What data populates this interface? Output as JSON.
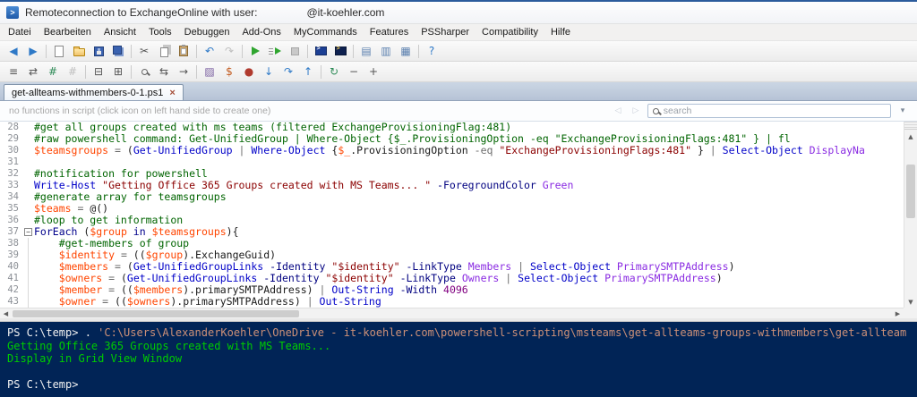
{
  "window": {
    "title_left": "Remoteconnection to ExchangeOnline with user:",
    "title_right": "@it-koehler.com",
    "app_icon": "powershell-ise-steroids"
  },
  "menu": {
    "items": [
      "Datei",
      "Bearbeiten",
      "Ansicht",
      "Tools",
      "Debuggen",
      "Add-Ons",
      "MyCommands",
      "Features",
      "PSSharper",
      "Compatibility",
      "Hilfe"
    ]
  },
  "toolbar1": {
    "icons": [
      {
        "name": "nav-back-icon",
        "glyph": "◀",
        "color": "#2E79C7"
      },
      {
        "name": "nav-forward-icon",
        "glyph": "▶",
        "color": "#2E79C7"
      },
      {
        "sep": true
      },
      {
        "name": "new-script-icon",
        "shape": "page"
      },
      {
        "name": "open-script-icon",
        "shape": "folder"
      },
      {
        "name": "save-icon",
        "shape": "disk"
      },
      {
        "name": "save-all-icon",
        "shape": "disk2"
      },
      {
        "sep": true
      },
      {
        "name": "cut-icon",
        "glyph": "✂",
        "color": "#555555"
      },
      {
        "name": "copy-icon",
        "shape": "copy"
      },
      {
        "name": "paste-icon",
        "shape": "paste"
      },
      {
        "sep": true
      },
      {
        "name": "undo-icon",
        "glyph": "↶",
        "color": "#2E79C7"
      },
      {
        "name": "redo-icon",
        "glyph": "↷",
        "color": "#B0B0B0",
        "disabled": true
      },
      {
        "sep": true
      },
      {
        "name": "run-script-icon",
        "shape": "play"
      },
      {
        "name": "run-selection-icon",
        "shape": "playsel"
      },
      {
        "name": "stop-icon",
        "shape": "stop",
        "disabled": true
      },
      {
        "sep": true
      },
      {
        "name": "new-remote-powershell-tab-icon",
        "shape": "console"
      },
      {
        "name": "start-powershell-exe-icon",
        "shape": "console2"
      },
      {
        "sep": true
      },
      {
        "name": "show-script-pane-icon",
        "glyph": "▤",
        "color": "#5A7FAE"
      },
      {
        "name": "show-console-pane-icon",
        "glyph": "▥",
        "color": "#5A7FAE"
      },
      {
        "name": "show-both-panes-icon",
        "glyph": "▦",
        "color": "#5A7FAE"
      },
      {
        "sep": true
      },
      {
        "name": "help-icon",
        "glyph": "?",
        "color": "#2E79C7"
      }
    ]
  },
  "toolbar2": {
    "icons": [
      {
        "name": "format-script-icon",
        "glyph": "≡",
        "color": "#555555"
      },
      {
        "name": "expand-alias-icon",
        "glyph": "⇄",
        "color": "#555555"
      },
      {
        "name": "comment-selection-icon",
        "glyph": "#",
        "color": "#2E8B57"
      },
      {
        "name": "uncomment-selection-icon",
        "glyph": "#",
        "color": "#B0B0B0",
        "disabled": true
      },
      {
        "sep": true
      },
      {
        "name": "collapse-regions-icon",
        "glyph": "⊟",
        "color": "#555555"
      },
      {
        "name": "expand-regions-icon",
        "glyph": "⊞",
        "color": "#555555"
      },
      {
        "sep": true
      },
      {
        "name": "find-icon",
        "shape": "magnifier"
      },
      {
        "name": "replace-icon",
        "glyph": "⇆",
        "color": "#555555"
      },
      {
        "name": "goto-line-icon",
        "glyph": "→",
        "color": "#555555"
      },
      {
        "sep": true
      },
      {
        "name": "snippets-icon",
        "glyph": "▨",
        "color": "#7A5FA0"
      },
      {
        "name": "variables-icon",
        "glyph": "$",
        "color": "#C25A1E"
      },
      {
        "name": "toggle-breakpoint-icon",
        "glyph": "●",
        "color": "#B03A2E"
      },
      {
        "name": "step-into-icon",
        "glyph": "↓",
        "color": "#2E79C7"
      },
      {
        "name": "step-over-icon",
        "glyph": "↷",
        "color": "#2E79C7"
      },
      {
        "name": "step-out-icon",
        "glyph": "↑",
        "color": "#2E79C7"
      },
      {
        "sep": true
      },
      {
        "name": "refresh-icon",
        "glyph": "↻",
        "color": "#2E8B57"
      },
      {
        "name": "zoom-out-icon",
        "glyph": "−",
        "color": "#555555"
      },
      {
        "name": "zoom-in-icon",
        "glyph": "+",
        "color": "#555555"
      }
    ]
  },
  "tabbar": {
    "active_label": "get-allteams-withmembers-0-1.ps1",
    "close_glyph": "×"
  },
  "funcbar": {
    "hint": "no functions in script (click icon on left hand side to create one)",
    "search_placeholder": "search"
  },
  "colors": {
    "syntax": {
      "comment": "#006400",
      "var": "#FF4500",
      "cmd": "#0000C8",
      "param": "#000080",
      "arg": "#8A2BE2",
      "str": "#8B0000",
      "op": "#6E6E6E",
      "kw": "#00008B",
      "num": "#800080",
      "plain": "#1A1A1A"
    },
    "console": {
      "background": "#012456",
      "text": "#F2F2F2",
      "green": "#00CC00",
      "string": "#CE9178"
    }
  },
  "editor": {
    "lines": [
      {
        "num": 28,
        "segments": [
          {
            "c": "comment",
            "t": "#get all groups created with ms teams (filtered ExchangeProvisioningFlag:481)"
          }
        ]
      },
      {
        "num": 29,
        "segments": [
          {
            "c": "comment",
            "t": "#raw powershell command: Get-UnifiedGroup | Where-Object {$_.ProvisioningOption -eq \"ExchangeProvisioningFlags:481\" } | fl"
          }
        ]
      },
      {
        "num": 30,
        "segments": [
          {
            "c": "var",
            "t": "$teamsgroups"
          },
          {
            "c": "op",
            "t": " = "
          },
          {
            "c": "plain",
            "t": "("
          },
          {
            "c": "cmd",
            "t": "Get-UnifiedGroup"
          },
          {
            "c": "op",
            "t": " | "
          },
          {
            "c": "cmd",
            "t": "Where-Object"
          },
          {
            "c": "plain",
            "t": " {"
          },
          {
            "c": "var",
            "t": "$_"
          },
          {
            "c": "plain",
            "t": ".ProvisioningOption"
          },
          {
            "c": "op",
            "t": " -eq "
          },
          {
            "c": "str",
            "t": "\"ExchangeProvisioningFlags:481\""
          },
          {
            "c": "plain",
            "t": " } "
          },
          {
            "c": "op",
            "t": "| "
          },
          {
            "c": "cmd",
            "t": "Select-Object"
          },
          {
            "c": "arg",
            "t": " DisplayNa"
          }
        ]
      },
      {
        "num": 31,
        "segments": []
      },
      {
        "num": 32,
        "segments": [
          {
            "c": "comment",
            "t": "#notification for powershell"
          }
        ]
      },
      {
        "num": 33,
        "segments": [
          {
            "c": "cmd",
            "t": "Write-Host"
          },
          {
            "c": "str",
            "t": " \"Getting Office 365 Groups created with MS Teams... \""
          },
          {
            "c": "param",
            "t": " -ForegroundColor"
          },
          {
            "c": "arg",
            "t": " Green"
          }
        ]
      },
      {
        "num": 34,
        "segments": [
          {
            "c": "comment",
            "t": "#generate array for teamsgroups"
          }
        ]
      },
      {
        "num": 35,
        "segments": [
          {
            "c": "var",
            "t": "$teams"
          },
          {
            "c": "op",
            "t": " = "
          },
          {
            "c": "plain",
            "t": "@()"
          }
        ]
      },
      {
        "num": 36,
        "segments": [
          {
            "c": "comment",
            "t": "#loop to get information"
          }
        ]
      },
      {
        "num": 37,
        "fold": true,
        "segments": [
          {
            "c": "kw",
            "t": "ForEach"
          },
          {
            "c": "plain",
            "t": " ("
          },
          {
            "c": "var",
            "t": "$group"
          },
          {
            "c": "kw",
            "t": " in "
          },
          {
            "c": "var",
            "t": "$teamsgroups"
          },
          {
            "c": "plain",
            "t": "){"
          }
        ]
      },
      {
        "num": 38,
        "guide": true,
        "segments": [
          {
            "c": "comment",
            "t": "    #get-members of group"
          }
        ]
      },
      {
        "num": 39,
        "guide": true,
        "segments": [
          {
            "c": "var",
            "t": "    $identity"
          },
          {
            "c": "op",
            "t": " = "
          },
          {
            "c": "plain",
            "t": "(("
          },
          {
            "c": "var",
            "t": "$group"
          },
          {
            "c": "plain",
            "t": ").ExchangeGuid)"
          }
        ]
      },
      {
        "num": 40,
        "guide": true,
        "segments": [
          {
            "c": "var",
            "t": "    $members"
          },
          {
            "c": "op",
            "t": " = "
          },
          {
            "c": "plain",
            "t": "("
          },
          {
            "c": "cmd",
            "t": "Get-UnifiedGroupLinks"
          },
          {
            "c": "param",
            "t": " -Identity"
          },
          {
            "c": "str",
            "t": " \"$identity\""
          },
          {
            "c": "param",
            "t": " -LinkType"
          },
          {
            "c": "arg",
            "t": " Members"
          },
          {
            "c": "op",
            "t": " | "
          },
          {
            "c": "cmd",
            "t": "Select-Object"
          },
          {
            "c": "arg",
            "t": " PrimarySMTPAddress"
          },
          {
            "c": "plain",
            "t": ")"
          }
        ]
      },
      {
        "num": 41,
        "guide": true,
        "segments": [
          {
            "c": "var",
            "t": "    $owners"
          },
          {
            "c": "op",
            "t": " = "
          },
          {
            "c": "plain",
            "t": "("
          },
          {
            "c": "cmd",
            "t": "Get-UnifiedGroupLinks"
          },
          {
            "c": "param",
            "t": " -Identity"
          },
          {
            "c": "str",
            "t": " \"$identity\""
          },
          {
            "c": "param",
            "t": " -LinkType"
          },
          {
            "c": "arg",
            "t": " Owners"
          },
          {
            "c": "op",
            "t": " | "
          },
          {
            "c": "cmd",
            "t": "Select-Object"
          },
          {
            "c": "arg",
            "t": " PrimarySMTPAddress"
          },
          {
            "c": "plain",
            "t": ")"
          }
        ]
      },
      {
        "num": 42,
        "guide": true,
        "segments": [
          {
            "c": "var",
            "t": "    $member"
          },
          {
            "c": "op",
            "t": " = "
          },
          {
            "c": "plain",
            "t": "(("
          },
          {
            "c": "var",
            "t": "$members"
          },
          {
            "c": "plain",
            "t": ").primarySMTPAddress)"
          },
          {
            "c": "op",
            "t": " | "
          },
          {
            "c": "cmd",
            "t": "Out-String"
          },
          {
            "c": "param",
            "t": " -Width"
          },
          {
            "c": "num",
            "t": " 4096"
          }
        ]
      },
      {
        "num": 43,
        "guide": true,
        "segments": [
          {
            "c": "var",
            "t": "    $owner"
          },
          {
            "c": "op",
            "t": " = "
          },
          {
            "c": "plain",
            "t": "(("
          },
          {
            "c": "var",
            "t": "$owners"
          },
          {
            "c": "plain",
            "t": ").primarySMTPAddress)"
          },
          {
            "c": "op",
            "t": " | "
          },
          {
            "c": "cmd",
            "t": "Out-String"
          }
        ]
      }
    ]
  },
  "console": {
    "lines": [
      {
        "segments": [
          {
            "c": "plain",
            "t": "PS C:\\temp> . "
          },
          {
            "c": "str",
            "t": "'C:\\Users\\AlexanderKoehler\\OneDrive - it-koehler.com\\powershell-scripting\\msteams\\get-allteams-groups-withmembers\\get-allteam"
          }
        ]
      },
      {
        "segments": [
          {
            "c": "green",
            "t": "Getting Office 365 Groups created with MS Teams..."
          }
        ]
      },
      {
        "segments": [
          {
            "c": "green",
            "t": "Display in Grid View Window"
          }
        ]
      },
      {
        "segments": []
      },
      {
        "segments": [
          {
            "c": "plain",
            "t": "PS C:\\temp>"
          }
        ]
      }
    ]
  }
}
